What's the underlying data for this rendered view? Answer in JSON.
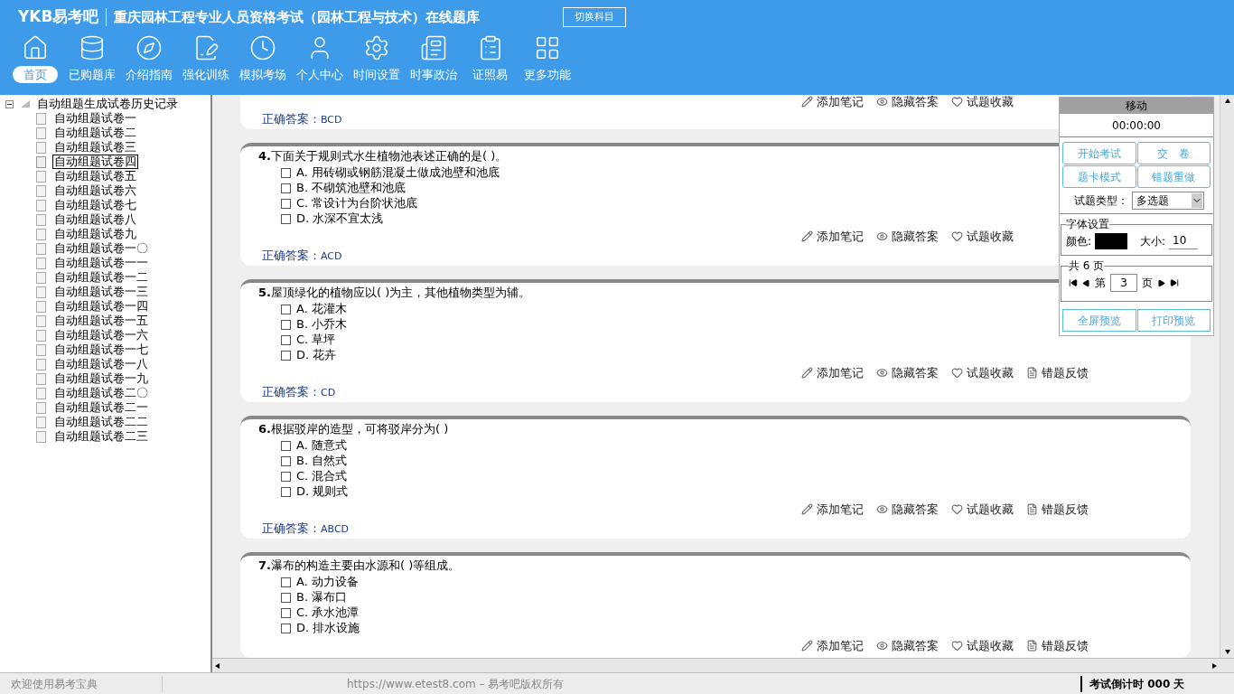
{
  "header": {
    "logo": "YKB易考吧",
    "title": "重庆园林工程专业人员资格考试（园林工程与技术）在线题库",
    "switch_button": "切换科目"
  },
  "nav": [
    {
      "label": "首页",
      "selected": true
    },
    {
      "label": "已购题库",
      "selected": false
    },
    {
      "label": "介绍指南",
      "selected": false
    },
    {
      "label": "强化训练",
      "selected": false
    },
    {
      "label": "模拟考场",
      "selected": false
    },
    {
      "label": "个人中心",
      "selected": false
    },
    {
      "label": "时间设置",
      "selected": false
    },
    {
      "label": "时事政治",
      "selected": false
    },
    {
      "label": "证照易",
      "selected": false
    },
    {
      "label": "更多功能",
      "selected": false
    }
  ],
  "tree": {
    "label": "自动组题生成试卷历史记录",
    "expanded": true,
    "children": [
      {
        "label": "自动组题试卷一",
        "selected": false
      },
      {
        "label": "自动组题试卷二",
        "selected": false
      },
      {
        "label": "自动组题试卷三",
        "selected": false
      },
      {
        "label": "自动组题试卷四",
        "selected": true
      },
      {
        "label": "自动组题试卷五",
        "selected": false
      },
      {
        "label": "自动组题试卷六",
        "selected": false
      },
      {
        "label": "自动组题试卷七",
        "selected": false
      },
      {
        "label": "自动组题试卷八",
        "selected": false
      },
      {
        "label": "自动组题试卷九",
        "selected": false
      },
      {
        "label": "自动组题试卷一〇",
        "selected": false
      },
      {
        "label": "自动组题试卷一一",
        "selected": false
      },
      {
        "label": "自动组题试卷一二",
        "selected": false
      },
      {
        "label": "自动组题试卷一三",
        "selected": false
      },
      {
        "label": "自动组题试卷一四",
        "selected": false
      },
      {
        "label": "自动组题试卷一五",
        "selected": false
      },
      {
        "label": "自动组题试卷一六",
        "selected": false
      },
      {
        "label": "自动组题试卷一七",
        "selected": false
      },
      {
        "label": "自动组题试卷一八",
        "selected": false
      },
      {
        "label": "自动组题试卷一九",
        "selected": false
      },
      {
        "label": "自动组题试卷二〇",
        "selected": false
      },
      {
        "label": "自动组题试卷二一",
        "selected": false
      },
      {
        "label": "自动组题试卷二二",
        "selected": false
      },
      {
        "label": "自动组题试卷二三",
        "selected": false
      }
    ]
  },
  "questions": [
    {
      "answer_label": "正确答案：",
      "answer": "BCD",
      "actions": [
        "添加笔记",
        "隐藏答案",
        "试题收藏"
      ]
    },
    {
      "number": "4.",
      "text": "下面关于规则式水生植物池表述正确的是( )。",
      "options": [
        {
          "label": "A. 用砖砌或钢筋混凝土做成池壁和池底",
          "checked": false
        },
        {
          "label": "B. 不砌筑池壁和池底",
          "checked": false
        },
        {
          "label": "C. 常设计为台阶状池底",
          "checked": false
        },
        {
          "label": "D. 水深不宜太浅",
          "checked": false
        }
      ],
      "answer_label": "正确答案：",
      "answer": "ACD",
      "actions": [
        "添加笔记",
        "隐藏答案",
        "试题收藏"
      ]
    },
    {
      "number": "5.",
      "text": "屋顶绿化的植物应以( )为主，其他植物类型为辅。",
      "options": [
        {
          "label": "A. 花灌木",
          "checked": false
        },
        {
          "label": "B. 小乔木",
          "checked": false
        },
        {
          "label": "C. 草坪",
          "checked": false
        },
        {
          "label": "D. 花卉",
          "checked": false
        }
      ],
      "answer_label": "正确答案：",
      "answer": "CD",
      "actions": [
        "添加笔记",
        "隐藏答案",
        "试题收藏",
        "错题反馈"
      ]
    },
    {
      "number": "6.",
      "text": "根据驳岸的造型，可将驳岸分为( )",
      "options": [
        {
          "label": "A. 随意式",
          "checked": false
        },
        {
          "label": "B. 自然式",
          "checked": false
        },
        {
          "label": "C. 混合式",
          "checked": false
        },
        {
          "label": "D. 规则式",
          "checked": false
        }
      ],
      "answer_label": "正确答案：",
      "answer": "ABCD",
      "actions": [
        "添加笔记",
        "隐藏答案",
        "试题收藏",
        "错题反馈"
      ]
    },
    {
      "number": "7.",
      "text": "瀑布的构造主要由水源和( )等组成。",
      "options": [
        {
          "label": "A. 动力设备",
          "checked": false
        },
        {
          "label": "B. 瀑布口",
          "checked": false
        },
        {
          "label": "C. 承水池潭",
          "checked": false
        },
        {
          "label": "D. 排水设施",
          "checked": false
        }
      ],
      "actions": [
        "添加笔记",
        "隐藏答案",
        "试题收藏",
        "错题反馈"
      ]
    }
  ],
  "panel": {
    "title": "移动",
    "timer": "00:00:00",
    "buttons": [
      "开始考试",
      "交　卷",
      "题卡模式",
      "错题重做"
    ],
    "type_label": "试题类型：",
    "type_value": "多选题",
    "font_group": "字体设置",
    "color_label": "颜色:",
    "color": "#000000",
    "size_label": "大小:",
    "size": "10",
    "pages_group": "共 6 页",
    "page_prefix": "第",
    "page": "3",
    "page_suffix": "页",
    "bottom_buttons": [
      "全屏预览",
      "打印预览"
    ]
  },
  "status_bar": {
    "welcome": "欢迎使用易考宝典",
    "copyright": "https://www.etest8.com – 易考吧版权所有",
    "countdown": "考试倒计时 000 天"
  }
}
